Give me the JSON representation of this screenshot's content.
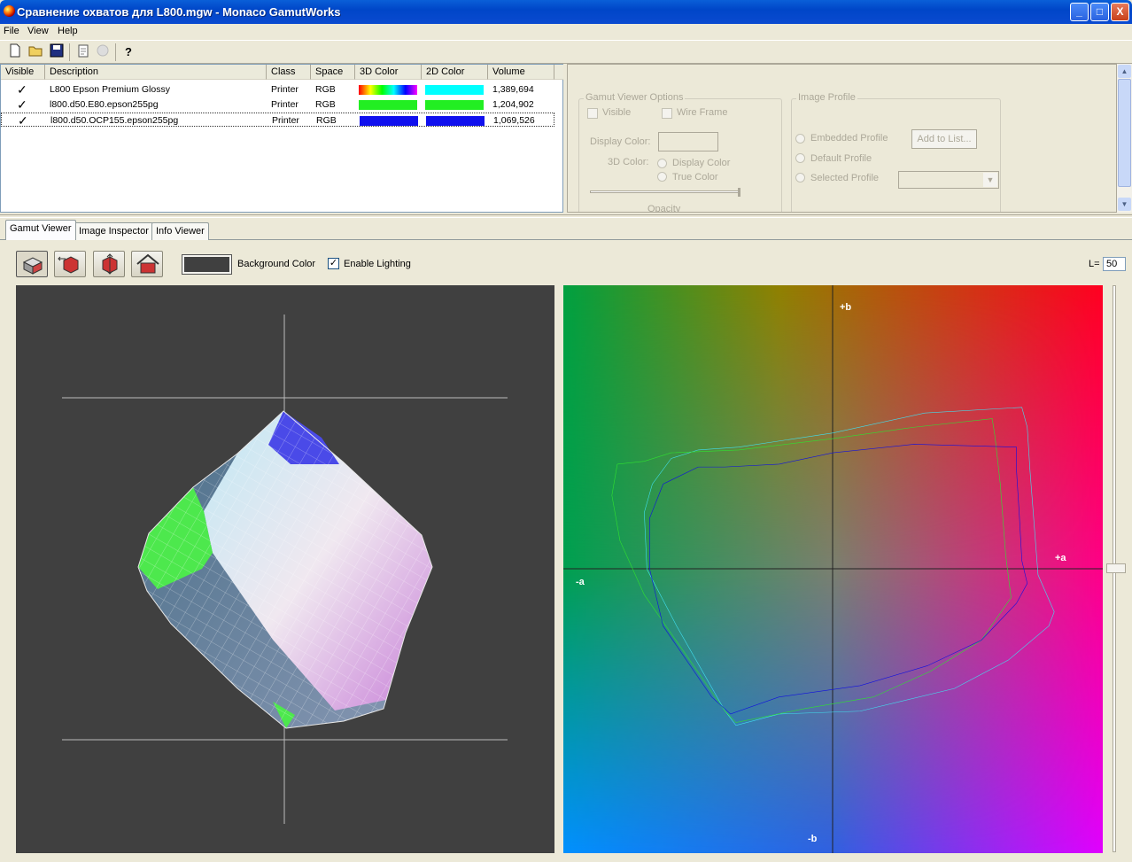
{
  "window": {
    "title": "Сравнение охватов для L800.mgw - Monaco GamutWorks",
    "min": "_",
    "max": "□",
    "close": "X"
  },
  "menu": [
    "File",
    "View",
    "Help"
  ],
  "toolbar": {
    "icons": [
      "new-file-icon",
      "open-folder-icon",
      "save-icon",
      "document-icon",
      "disabled-icon",
      "help-icon"
    ]
  },
  "table": {
    "headers": [
      "Visible",
      "Description",
      "Class",
      "Space",
      "3D Color",
      "2D Color",
      "Volume"
    ],
    "rows": [
      {
        "visible": "✓",
        "description": "L800 Epson Premium Glossy",
        "class": "Printer",
        "space": "RGB",
        "c3d": "rainbow",
        "c2d": "#00ffff",
        "volume": "1,389,694"
      },
      {
        "visible": "✓",
        "description": "l800.d50.E80.epson255pg",
        "class": "Printer",
        "space": "RGB",
        "c3d": "#22ee22",
        "c2d": "#22ee22",
        "volume": "1,204,902"
      },
      {
        "visible": "✓",
        "description": "l800.d50.OCP155.epson255pg",
        "class": "Printer",
        "space": "RGB",
        "c3d": "#1010ee",
        "c2d": "#1010ee",
        "volume": "1,069,526"
      }
    ]
  },
  "options": {
    "group1": "Gamut Viewer Options",
    "visible": "Visible",
    "wireframe": "Wire Frame",
    "display_color": "Display Color:",
    "color3d": "3D Color:",
    "display_color_radio": "Display Color",
    "true_color": "True Color",
    "opacity": "Opacity",
    "group2": "Image Profile",
    "embedded": "Embedded Profile",
    "add_to_list": "Add to List...",
    "default": "Default Profile",
    "selected": "Selected Profile"
  },
  "tabs": [
    "Gamut Viewer",
    "Image Inspector",
    "Info Viewer"
  ],
  "viewer": {
    "background_color": "Background Color",
    "enable_lighting": "Enable Lighting",
    "lighting_checked": "✓",
    "l_label": "L=",
    "l_value": "50",
    "bg_swatch": "#404040"
  },
  "plot2d": {
    "plus_b": "+b",
    "minus_b": "-b",
    "plus_a": "+a",
    "minus_a": "-a"
  }
}
